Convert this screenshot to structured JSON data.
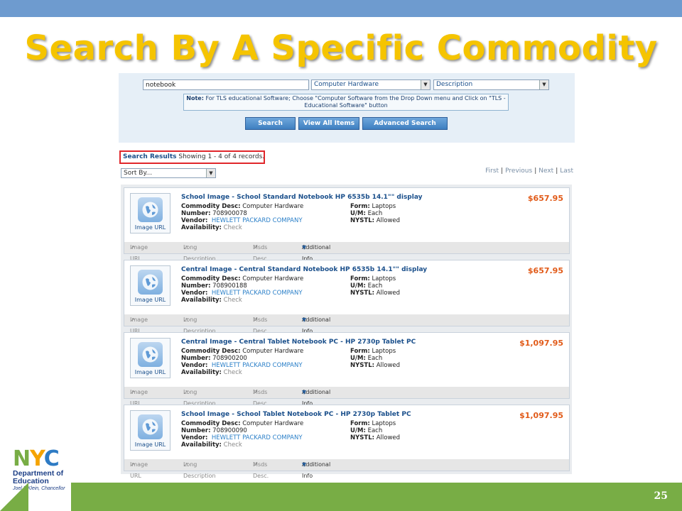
{
  "slide": {
    "title": "Search By A Specific Commodity",
    "page_number": "25",
    "colors": {
      "top_bar": "#6e9bcf",
      "title": "#f5c400",
      "bottom_bar": "#78ad45"
    }
  },
  "search": {
    "query": "notebook",
    "category": "Computer Hardware",
    "field": "Description",
    "note_label": "Note:",
    "note_text": "For TLS educational Software; Choose \"Computer Software from the Drop Down menu and Click on \"TLS - Educational Software\" button",
    "buttons": {
      "search": "Search",
      "view_all": "View All Items",
      "advanced": "Advanced Search"
    }
  },
  "results": {
    "label": "Search Results",
    "summary": "Showing 1 - 4 of 4 records.",
    "sort_by": "Sort By...",
    "pager": {
      "first": "First",
      "previous": "Previous",
      "next": "Next",
      "last": "Last"
    }
  },
  "labels": {
    "image_caption": "Image URL",
    "commodity_desc": "Commodity Desc:",
    "number": "Number:",
    "vendor": "Vendor:",
    "availability": "Availability:",
    "form": "Form:",
    "um": "U/M:",
    "nystl": "NYSTL:",
    "footer_image_url": "Image URL",
    "footer_long_desc": "Long Description",
    "footer_msds": "Msds Desc.",
    "footer_additional": "Additional Info"
  },
  "items": [
    {
      "title": "School Image - School Standard Notebook HP 6535b 14.1\"\" display",
      "price": "$657.95",
      "commodity_desc": "Computer Hardware",
      "number": "708900078",
      "vendor": "HEWLETT PACKARD COMPANY",
      "availability": "Check",
      "form": "Laptops",
      "um": "Each",
      "nystl": "Allowed"
    },
    {
      "title": "Central Image - Central Standard Notebook HP 6535b 14.1\"\" display",
      "price": "$657.95",
      "commodity_desc": "Computer Hardware",
      "number": "708900188",
      "vendor": "HEWLETT PACKARD COMPANY",
      "availability": "Check",
      "form": "Laptops",
      "um": "Each",
      "nystl": "Allowed"
    },
    {
      "title": "Central Image - Central Tablet Notebook PC - HP 2730p Tablet PC",
      "price": "$1,097.95",
      "commodity_desc": "Computer Hardware",
      "number": "708900200",
      "vendor": "HEWLETT PACKARD COMPANY",
      "availability": "Check",
      "form": "Laptops",
      "um": "Each",
      "nystl": "Allowed"
    },
    {
      "title": "School Image - School Tablet Notebook PC - HP 2730p Tablet PC",
      "price": "$1,097.95",
      "commodity_desc": "Computer Hardware",
      "number": "708900090",
      "vendor": "HEWLETT PACKARD COMPANY",
      "availability": "Check",
      "form": "Laptops",
      "um": "Each",
      "nystl": "Allowed"
    }
  ],
  "logo": {
    "letters": [
      "N",
      "Y",
      "C"
    ],
    "letter_colors": [
      "#78ad45",
      "#f5a300",
      "#2e7bc4"
    ],
    "line1": "Department of",
    "line2": "Education",
    "line3": "Joel I. Klein, Chancellor"
  }
}
